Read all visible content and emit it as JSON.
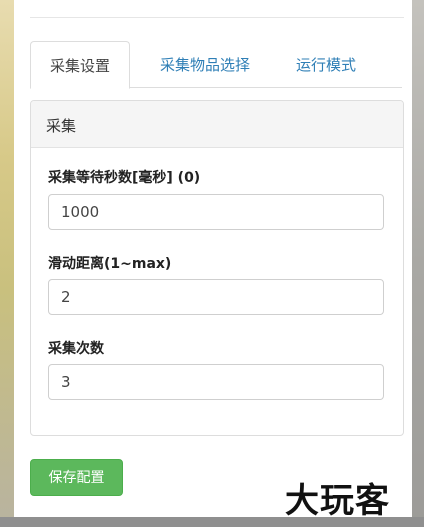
{
  "tabs": [
    {
      "label": "采集设置"
    },
    {
      "label": "采集物品选择"
    },
    {
      "label": "运行模式"
    }
  ],
  "group": {
    "title": "采集",
    "fields": [
      {
        "label": "采集等待秒数[毫秒] (0)",
        "value": "1000"
      },
      {
        "label": "滑动距离(1~max)",
        "value": "2"
      },
      {
        "label": "采集次数",
        "value": "3"
      }
    ]
  },
  "save_button": {
    "label": "保存配置"
  },
  "watermark": "大玩客",
  "colors": {
    "tab_link": "#2f7fb6",
    "save_button": "#5cb85c",
    "group_header_bg": "#f5f5f5"
  }
}
